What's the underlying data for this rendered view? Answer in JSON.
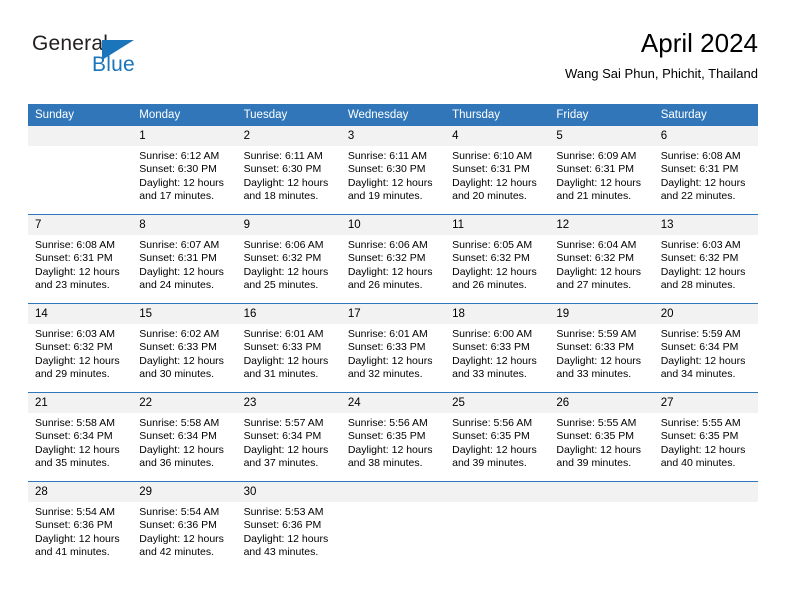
{
  "brand": {
    "name_part1": "General",
    "name_part2": "Blue",
    "triangle_color": "#1b75bb",
    "text_color": "#231f20"
  },
  "header": {
    "month_title": "April 2024",
    "location": "Wang Sai Phun, Phichit, Thailand"
  },
  "theme": {
    "header_blue": "#3176b8",
    "day_band_gray": "#f2f2f2",
    "separator_blue": "#3176b8"
  },
  "weekday_headers": [
    "Sunday",
    "Monday",
    "Tuesday",
    "Wednesday",
    "Thursday",
    "Friday",
    "Saturday"
  ],
  "labels": {
    "sunrise_prefix": "Sunrise:",
    "sunset_prefix": "Sunset:",
    "daylight_prefix": "Daylight:"
  },
  "weeks": [
    [
      {
        "day": "",
        "empty": true,
        "l1": "",
        "l2": "",
        "l3": "",
        "l4": ""
      },
      {
        "day": "1",
        "l1": "Sunrise: 6:12 AM",
        "l2": "Sunset: 6:30 PM",
        "l3": "Daylight: 12 hours",
        "l4": "and 17 minutes."
      },
      {
        "day": "2",
        "l1": "Sunrise: 6:11 AM",
        "l2": "Sunset: 6:30 PM",
        "l3": "Daylight: 12 hours",
        "l4": "and 18 minutes."
      },
      {
        "day": "3",
        "l1": "Sunrise: 6:11 AM",
        "l2": "Sunset: 6:30 PM",
        "l3": "Daylight: 12 hours",
        "l4": "and 19 minutes."
      },
      {
        "day": "4",
        "l1": "Sunrise: 6:10 AM",
        "l2": "Sunset: 6:31 PM",
        "l3": "Daylight: 12 hours",
        "l4": "and 20 minutes."
      },
      {
        "day": "5",
        "l1": "Sunrise: 6:09 AM",
        "l2": "Sunset: 6:31 PM",
        "l3": "Daylight: 12 hours",
        "l4": "and 21 minutes."
      },
      {
        "day": "6",
        "l1": "Sunrise: 6:08 AM",
        "l2": "Sunset: 6:31 PM",
        "l3": "Daylight: 12 hours",
        "l4": "and 22 minutes."
      }
    ],
    [
      {
        "day": "7",
        "l1": "Sunrise: 6:08 AM",
        "l2": "Sunset: 6:31 PM",
        "l3": "Daylight: 12 hours",
        "l4": "and 23 minutes."
      },
      {
        "day": "8",
        "l1": "Sunrise: 6:07 AM",
        "l2": "Sunset: 6:31 PM",
        "l3": "Daylight: 12 hours",
        "l4": "and 24 minutes."
      },
      {
        "day": "9",
        "l1": "Sunrise: 6:06 AM",
        "l2": "Sunset: 6:32 PM",
        "l3": "Daylight: 12 hours",
        "l4": "and 25 minutes."
      },
      {
        "day": "10",
        "l1": "Sunrise: 6:06 AM",
        "l2": "Sunset: 6:32 PM",
        "l3": "Daylight: 12 hours",
        "l4": "and 26 minutes."
      },
      {
        "day": "11",
        "l1": "Sunrise: 6:05 AM",
        "l2": "Sunset: 6:32 PM",
        "l3": "Daylight: 12 hours",
        "l4": "and 26 minutes."
      },
      {
        "day": "12",
        "l1": "Sunrise: 6:04 AM",
        "l2": "Sunset: 6:32 PM",
        "l3": "Daylight: 12 hours",
        "l4": "and 27 minutes."
      },
      {
        "day": "13",
        "l1": "Sunrise: 6:03 AM",
        "l2": "Sunset: 6:32 PM",
        "l3": "Daylight: 12 hours",
        "l4": "and 28 minutes."
      }
    ],
    [
      {
        "day": "14",
        "l1": "Sunrise: 6:03 AM",
        "l2": "Sunset: 6:32 PM",
        "l3": "Daylight: 12 hours",
        "l4": "and 29 minutes."
      },
      {
        "day": "15",
        "l1": "Sunrise: 6:02 AM",
        "l2": "Sunset: 6:33 PM",
        "l3": "Daylight: 12 hours",
        "l4": "and 30 minutes."
      },
      {
        "day": "16",
        "l1": "Sunrise: 6:01 AM",
        "l2": "Sunset: 6:33 PM",
        "l3": "Daylight: 12 hours",
        "l4": "and 31 minutes."
      },
      {
        "day": "17",
        "l1": "Sunrise: 6:01 AM",
        "l2": "Sunset: 6:33 PM",
        "l3": "Daylight: 12 hours",
        "l4": "and 32 minutes."
      },
      {
        "day": "18",
        "l1": "Sunrise: 6:00 AM",
        "l2": "Sunset: 6:33 PM",
        "l3": "Daylight: 12 hours",
        "l4": "and 33 minutes."
      },
      {
        "day": "19",
        "l1": "Sunrise: 5:59 AM",
        "l2": "Sunset: 6:33 PM",
        "l3": "Daylight: 12 hours",
        "l4": "and 33 minutes."
      },
      {
        "day": "20",
        "l1": "Sunrise: 5:59 AM",
        "l2": "Sunset: 6:34 PM",
        "l3": "Daylight: 12 hours",
        "l4": "and 34 minutes."
      }
    ],
    [
      {
        "day": "21",
        "l1": "Sunrise: 5:58 AM",
        "l2": "Sunset: 6:34 PM",
        "l3": "Daylight: 12 hours",
        "l4": "and 35 minutes."
      },
      {
        "day": "22",
        "l1": "Sunrise: 5:58 AM",
        "l2": "Sunset: 6:34 PM",
        "l3": "Daylight: 12 hours",
        "l4": "and 36 minutes."
      },
      {
        "day": "23",
        "l1": "Sunrise: 5:57 AM",
        "l2": "Sunset: 6:34 PM",
        "l3": "Daylight: 12 hours",
        "l4": "and 37 minutes."
      },
      {
        "day": "24",
        "l1": "Sunrise: 5:56 AM",
        "l2": "Sunset: 6:35 PM",
        "l3": "Daylight: 12 hours",
        "l4": "and 38 minutes."
      },
      {
        "day": "25",
        "l1": "Sunrise: 5:56 AM",
        "l2": "Sunset: 6:35 PM",
        "l3": "Daylight: 12 hours",
        "l4": "and 39 minutes."
      },
      {
        "day": "26",
        "l1": "Sunrise: 5:55 AM",
        "l2": "Sunset: 6:35 PM",
        "l3": "Daylight: 12 hours",
        "l4": "and 39 minutes."
      },
      {
        "day": "27",
        "l1": "Sunrise: 5:55 AM",
        "l2": "Sunset: 6:35 PM",
        "l3": "Daylight: 12 hours",
        "l4": "and 40 minutes."
      }
    ],
    [
      {
        "day": "28",
        "l1": "Sunrise: 5:54 AM",
        "l2": "Sunset: 6:36 PM",
        "l3": "Daylight: 12 hours",
        "l4": "and 41 minutes."
      },
      {
        "day": "29",
        "l1": "Sunrise: 5:54 AM",
        "l2": "Sunset: 6:36 PM",
        "l3": "Daylight: 12 hours",
        "l4": "and 42 minutes."
      },
      {
        "day": "30",
        "l1": "Sunrise: 5:53 AM",
        "l2": "Sunset: 6:36 PM",
        "l3": "Daylight: 12 hours",
        "l4": "and 43 minutes."
      },
      {
        "day": "",
        "empty": true,
        "l1": "",
        "l2": "",
        "l3": "",
        "l4": ""
      },
      {
        "day": "",
        "empty": true,
        "l1": "",
        "l2": "",
        "l3": "",
        "l4": ""
      },
      {
        "day": "",
        "empty": true,
        "l1": "",
        "l2": "",
        "l3": "",
        "l4": ""
      },
      {
        "day": "",
        "empty": true,
        "l1": "",
        "l2": "",
        "l3": "",
        "l4": ""
      }
    ]
  ]
}
